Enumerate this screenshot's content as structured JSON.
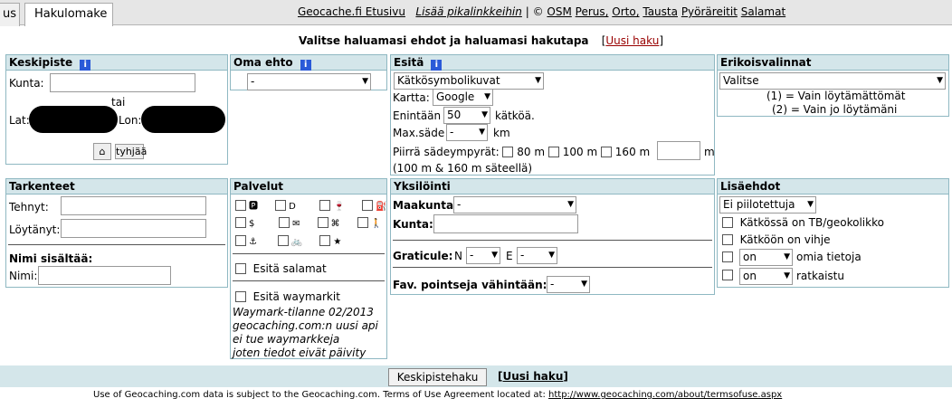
{
  "tabs": {
    "prev": "us",
    "active": "Hakulomake"
  },
  "toplinks": {
    "etusivu": "Geocache.fi Etusivu",
    "pikalinkit": "Lisää pikalinkkeihin",
    "sep": "|",
    "copy": "©",
    "osm": "OSM",
    "perus": "Perus,",
    "orto": "Orto,",
    "tausta": "Tausta",
    "pyora": "Pyöräreitit",
    "salamat": "Salamat"
  },
  "headline": {
    "text": "Valitse haluamasi ehdot ja haluamasi hakutapa",
    "lb": "[",
    "link": "Uusi haku",
    "rb": "]"
  },
  "keskipiste": {
    "title": "Keskipiste",
    "kunta_label": "Kunta:",
    "tai": "tai",
    "lat_label": "Lat:",
    "lon_label": "Lon:",
    "home_icon": "house-icon",
    "tyhjaa": "tyhjää"
  },
  "omaehto": {
    "title": "Oma ehto",
    "select": "-"
  },
  "esita": {
    "title": "Esitä",
    "symbol_select": "Kätkösymbolikuvat",
    "kartta_label": "Kartta:",
    "kartta_value": "Google",
    "enintaan_label": "Enintään",
    "enintaan_value": "50",
    "katkoa": "kätköä.",
    "maxsade_label": "Max.säde",
    "maxsade_value": "-",
    "km": "km",
    "piirra": "Piirrä sädeympyrät:",
    "r80": "80 m",
    "r100": "100 m",
    "r160": "160 m",
    "m": "m",
    "note": "(100 m & 160 m säteellä)"
  },
  "erikois": {
    "title": "Erikoisvalinnat",
    "select": "Valitse",
    "opt1": "(1) = Vain löytämättömät",
    "opt2": "(2) = Vain jo löytämäni"
  },
  "tarkenteet": {
    "title": "Tarkenteet",
    "tehnyt": "Tehnyt:",
    "loytanyt": "Löytänyt:",
    "nimi_title": "Nimi sisältää:",
    "nimi": "Nimi:"
  },
  "palvelut": {
    "title": "Palvelut",
    "icons": [
      "parking-icon",
      "door-icon",
      "wine-icon",
      "fuel-icon",
      "dollar-icon",
      "mailbox-icon",
      "attraction-icon",
      "hiker-icon",
      "anchor-icon",
      "bicycle-icon",
      "star-icon"
    ],
    "glyphs": [
      "🅿",
      "D",
      "🍷",
      "⛽",
      "$",
      "✉",
      "⌘",
      "🚶",
      "⚓",
      "🚲",
      "★"
    ],
    "salamat": "Esitä salamat",
    "waymarkit": "Esitä waymarkit",
    "note1": "Waymark-tilanne 02/2013",
    "note2": "geocaching.com:n uusi api",
    "note3": "ei tue waymarkkeja",
    "note4": "joten tiedot eivät päivity"
  },
  "yksilointi": {
    "title": "Yksilöinti",
    "maakunta": "Maakunta:",
    "maakunta_value": "-",
    "kunta": "Kunta:",
    "graticule": "Graticule:",
    "n": "N",
    "n_value": "-",
    "e": "E",
    "e_value": "-",
    "fav": "Fav. pointseja vähintään:",
    "fav_value": "-"
  },
  "lisaehdot": {
    "title": "Lisäehdot",
    "select": "Ei piilotettuja",
    "tb": "Kätkössä on TB/geokolikko",
    "vihje": "Kätköön on vihje",
    "on1": "on",
    "omia": "omia tietoja",
    "on2": "on",
    "ratkaistu": "ratkaistu"
  },
  "bottom": {
    "button": "Keskipistehaku",
    "lb": "[",
    "link": "Uusi haku",
    "rb": "]"
  },
  "footer": {
    "text": "Use of Geocaching.com data is subject to the Geocaching.com. Terms of Use Agreement located at:",
    "url": "http://www.geocaching.com/about/termsofuse.aspx"
  }
}
